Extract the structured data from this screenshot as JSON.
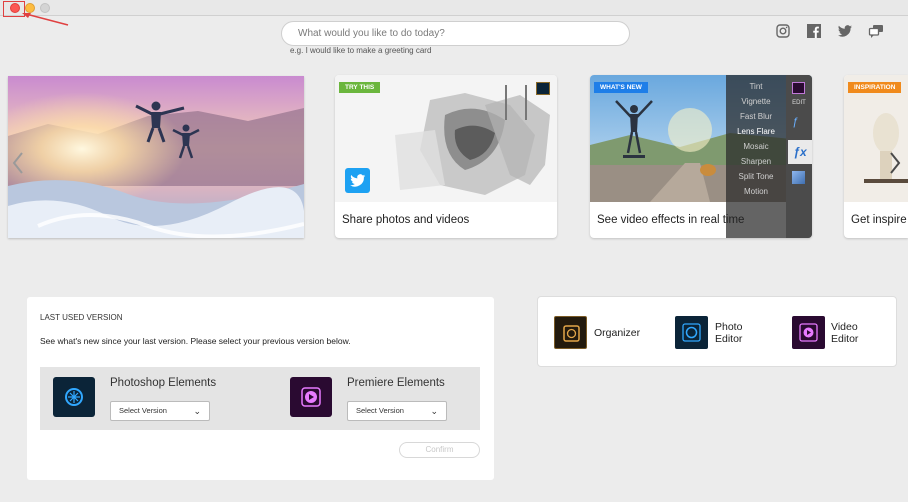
{
  "search": {
    "placeholder": "What would you like to do today?",
    "hint": "e.g. I would like to make a greeting card"
  },
  "social": [
    "instagram-icon",
    "facebook-icon",
    "twitter-icon",
    "chat-icon"
  ],
  "carousel": {
    "cards": [
      {
        "badge": "TRY THIS",
        "badge_color": "#6bb63d",
        "caption": "Share photos and videos"
      },
      {
        "badge": "WHAT'S NEW",
        "badge_color": "#1e7ee8",
        "caption": "See video effects in real time",
        "effects": [
          "Tint",
          "Vignette",
          "Fast Blur",
          "Lens Flare",
          "Mosaic",
          "Sharpen",
          "Split Tone",
          "Motion"
        ],
        "edit_label": "EDIT"
      },
      {
        "badge": "INSPIRATION",
        "badge_color": "#f08a1c",
        "caption": "Get inspire"
      }
    ]
  },
  "last_used": {
    "heading": "LAST USED VERSION",
    "description": "See what's new since your last version. Please select your previous version below.",
    "products": [
      {
        "name": "Photoshop Elements",
        "select": "Select Version"
      },
      {
        "name": "Premiere Elements",
        "select": "Select Version"
      }
    ],
    "confirm": "Confirm"
  },
  "apps": [
    {
      "label": "Organizer"
    },
    {
      "label": "Photo\nEditor"
    },
    {
      "label": "Video\nEditor"
    }
  ],
  "colors": {
    "accent_ps": "#31a8ff",
    "accent_pr": "#e77bff",
    "dark_icon": "#0b2438",
    "dark_pr": "#2a0a31"
  }
}
